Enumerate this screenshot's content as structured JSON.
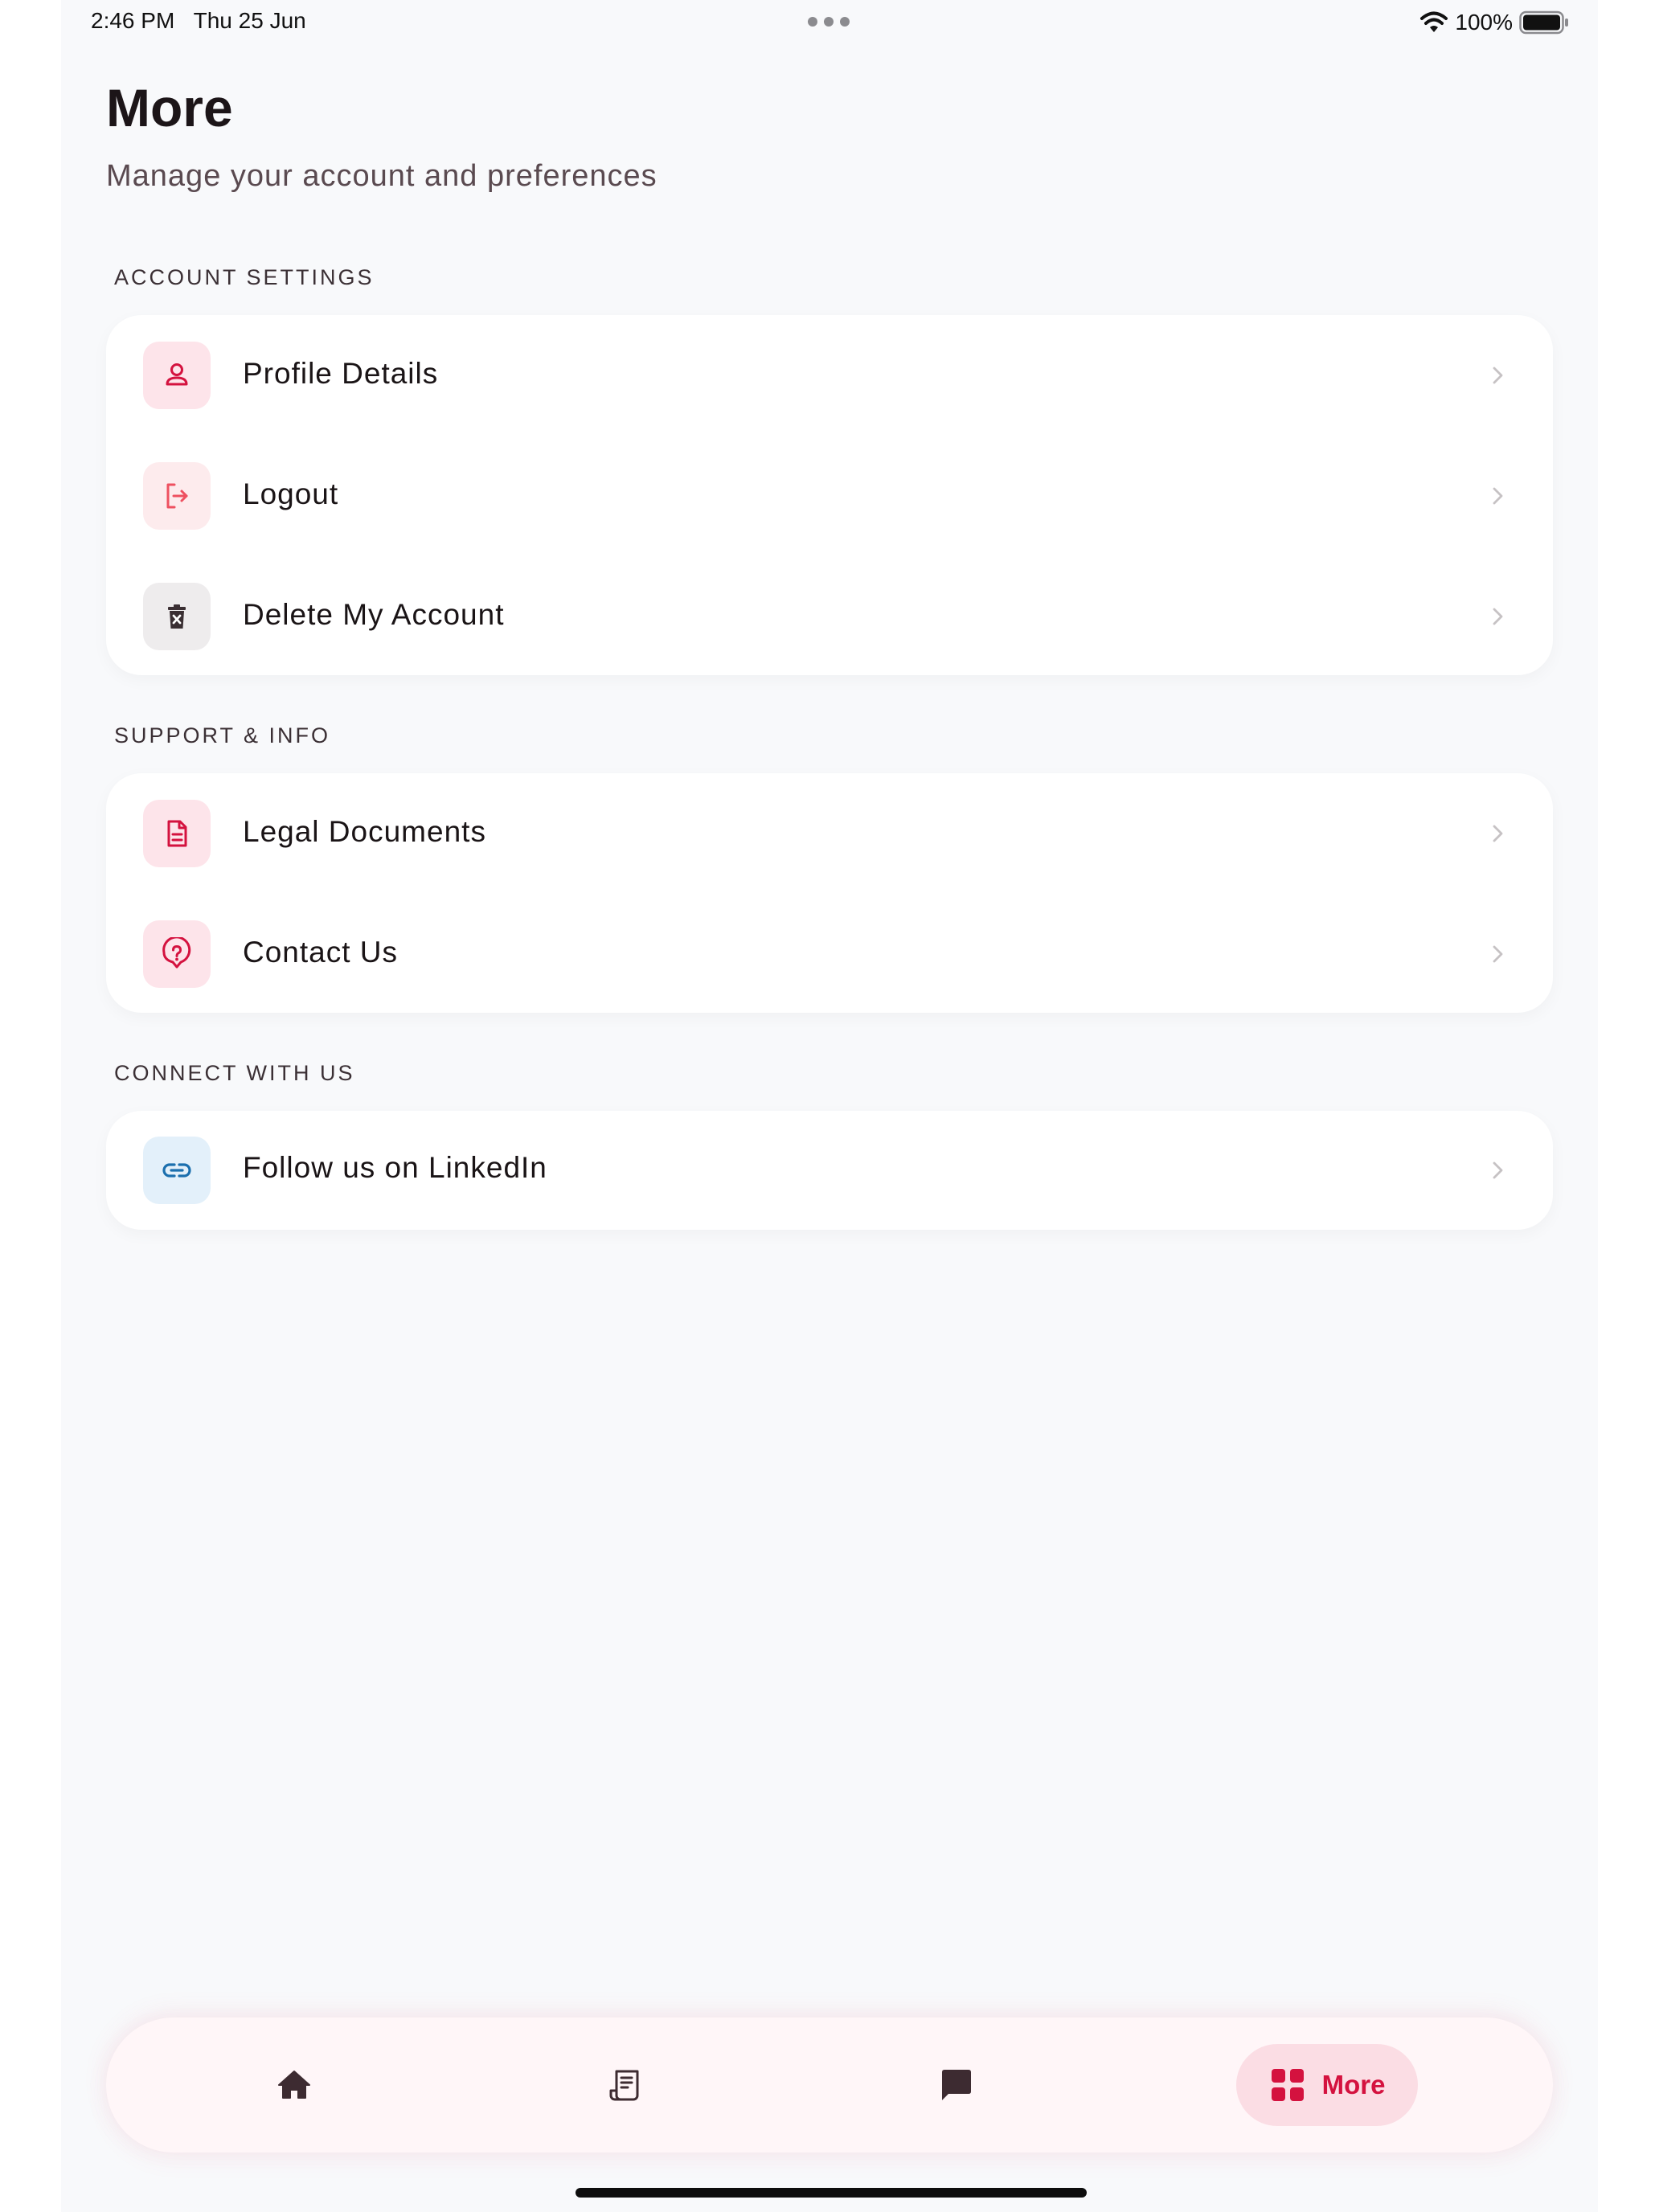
{
  "status_bar": {
    "time": "2:46 PM",
    "date": "Thu 25 Jun",
    "battery": "100%"
  },
  "header": {
    "title": "More",
    "subtitle": "Manage your account and preferences"
  },
  "sections": {
    "account": {
      "label": "ACCOUNT SETTINGS",
      "items": [
        {
          "label": "Profile Details",
          "icon": "user-icon"
        },
        {
          "label": "Logout",
          "icon": "logout-icon"
        },
        {
          "label": "Delete My Account",
          "icon": "trash-icon"
        }
      ]
    },
    "support": {
      "label": "SUPPORT & INFO",
      "items": [
        {
          "label": "Legal Documents",
          "icon": "document-icon"
        },
        {
          "label": "Contact Us",
          "icon": "help-icon"
        }
      ]
    },
    "connect": {
      "label": "CONNECT WITH US",
      "items": [
        {
          "label": "Follow us on LinkedIn",
          "icon": "link-icon"
        }
      ]
    }
  },
  "tab_bar": {
    "items": [
      {
        "icon": "home-icon"
      },
      {
        "icon": "receipt-icon"
      },
      {
        "icon": "chat-icon"
      },
      {
        "icon": "grid-icon",
        "label": "More",
        "active": true
      }
    ]
  },
  "colors": {
    "accent": "#d4123f",
    "accent_soft": "#fbdde4",
    "background": "#f8f9fb",
    "card": "#ffffff",
    "linkedin_blue": "#1b6fae"
  }
}
